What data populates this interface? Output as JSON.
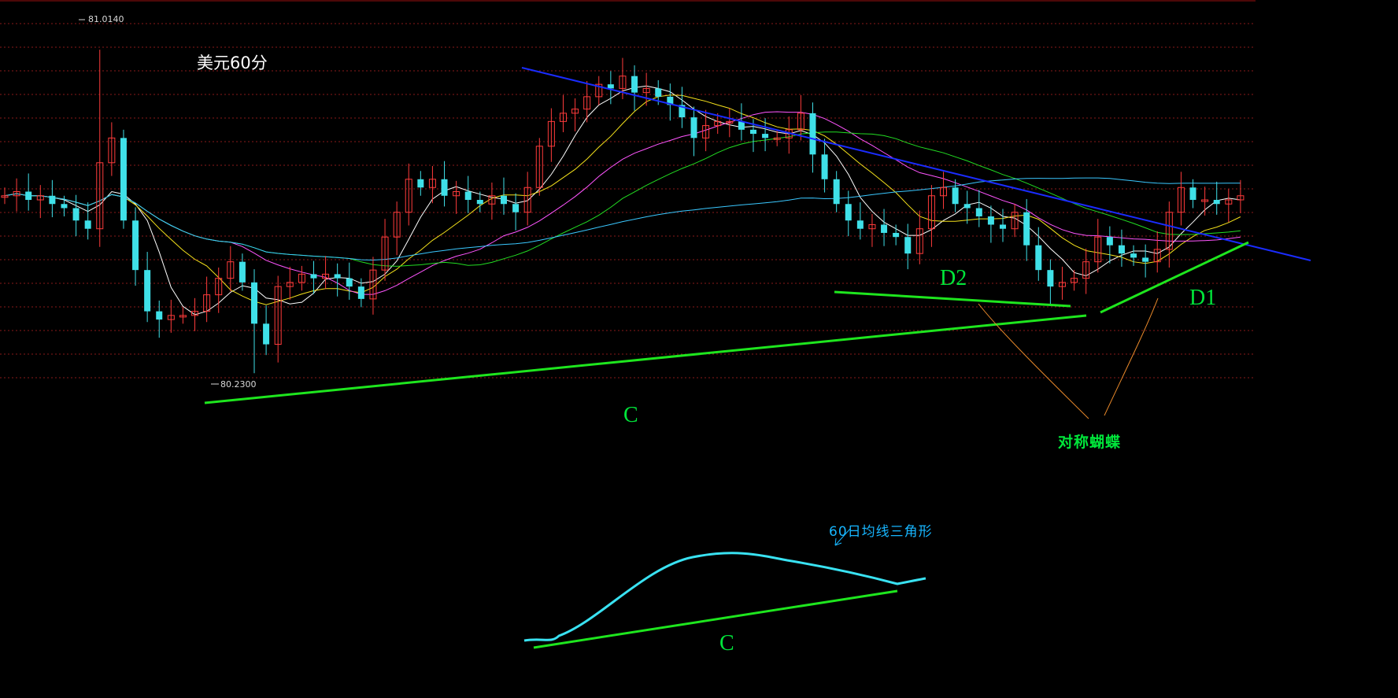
{
  "title": "美元60分",
  "annotations": {
    "c_main": "C",
    "c_sketch": "C",
    "d1": "D1",
    "d2": "D2",
    "butterfly": "对称蝴蝶",
    "ma60_triangle": "60日均线三角形"
  },
  "price_labels": {
    "high": "81.0140",
    "low": "80.2300"
  },
  "colors": {
    "background": "#000000",
    "up_candle": "#ff3b3b",
    "down_candle": "#3fe0e8",
    "grid": "#8a1a1a",
    "trend_blue": "#1a2cff",
    "trend_green": "#1ee61e",
    "ma5": "#ffffff",
    "ma10": "#f5e21b",
    "ma20": "#ff55ff",
    "ma30": "#22dd22",
    "ma60": "#3ac8ff"
  },
  "chart_data": {
    "type": "candlestick",
    "timeframe": "60 min",
    "ylim": [
      80.2,
      81.1
    ],
    "high_extreme": 81.014,
    "low_extreme": 80.23,
    "closes": [
      80.66,
      80.67,
      80.65,
      80.66,
      80.64,
      80.63,
      80.6,
      80.58,
      80.74,
      80.8,
      80.6,
      80.48,
      80.38,
      80.36,
      80.37,
      80.37,
      80.38,
      80.42,
      80.46,
      80.5,
      80.45,
      80.35,
      80.3,
      80.44,
      80.45,
      80.47,
      80.46,
      80.47,
      80.46,
      80.44,
      80.41,
      80.48,
      80.56,
      80.62,
      80.7,
      80.68,
      80.7,
      80.66,
      80.67,
      80.65,
      80.64,
      80.66,
      80.64,
      80.62,
      80.68,
      80.78,
      80.84,
      80.86,
      80.87,
      80.9,
      80.93,
      80.92,
      80.95,
      80.91,
      80.92,
      80.9,
      80.88,
      80.85,
      80.8,
      80.83,
      80.84,
      80.84,
      80.82,
      80.81,
      80.8,
      80.8,
      80.82,
      80.86,
      80.76,
      80.7,
      80.64,
      80.6,
      80.58,
      80.59,
      80.57,
      80.56,
      80.52,
      80.58,
      80.66,
      80.68,
      80.64,
      80.63,
      80.61,
      80.59,
      80.58,
      80.62,
      80.54,
      80.48,
      80.44,
      80.45,
      80.46,
      80.5,
      80.56,
      80.54,
      80.52,
      80.51,
      80.5,
      80.53,
      80.62,
      80.68,
      80.65,
      80.65,
      80.64,
      80.65,
      80.66
    ],
    "ma60_trend": "rising, rounding over, then flattening (60日均线三角形)",
    "patterns": [
      {
        "label": "C",
        "type": "ascending support line"
      },
      {
        "label": "D1",
        "type": "rising trendline"
      },
      {
        "label": "D2",
        "type": "flat support line"
      },
      {
        "label": "",
        "type": "descending resistance line",
        "color": "blue"
      }
    ]
  }
}
